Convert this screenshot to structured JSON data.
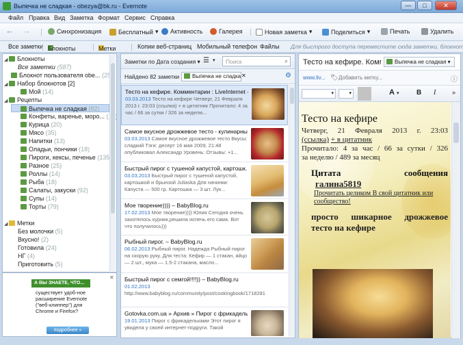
{
  "window": {
    "title": "Выпечка не сладкая - obezya@bk.ru - Evernote",
    "min": "—",
    "max": "□",
    "close": "✕"
  },
  "menu": [
    "Файл",
    "Правка",
    "Вид",
    "Заметка",
    "Формат",
    "Сервис",
    "Справка"
  ],
  "toolbar": {
    "sync": "Синхронизация",
    "account": "Бесплатный",
    "activity": "Активность",
    "gallery": "Галерея",
    "new_note": "Новая заметка",
    "share": "Поделиться",
    "print": "Печать",
    "delete": "Удалить"
  },
  "navbar": {
    "all_notes": "Все заметки",
    "notebooks": "Блокноты",
    "tags": "Метки",
    "web_clips": "Копии веб-страниц",
    "mobile": "Мобильный телефон",
    "files": "Файлы",
    "hint": "Для быстрого доступа переместите сюда заметки, блокноты и ..."
  },
  "sidebar": {
    "notebooks_header": "Блокноты",
    "items": [
      {
        "label": "Все заметки",
        "count": "(587)"
      },
      {
        "label": "Блокнот пользователя obe...",
        "count": "(25)"
      },
      {
        "label": "Набор блокнотов [2]",
        "count": ""
      },
      {
        "label": "Мой",
        "count": "(14)"
      },
      {
        "label": "Рецепты",
        "count": ""
      },
      {
        "label": "Выпечка не сладкая",
        "count": "(82)"
      },
      {
        "label": "Конфеты, варенье, моро...",
        "count": "(15)"
      },
      {
        "label": "Курица",
        "count": "(20)"
      },
      {
        "label": "Мясо",
        "count": "(35)"
      },
      {
        "label": "Напитки",
        "count": "(13)"
      },
      {
        "label": "Оладьи, пончики",
        "count": "(18)"
      },
      {
        "label": "Пироги, кексы, печенье",
        "count": "(135)"
      },
      {
        "label": "Разное",
        "count": "(25)"
      },
      {
        "label": "Роллы",
        "count": "(14)"
      },
      {
        "label": "Рыба",
        "count": "(18)"
      },
      {
        "label": "Салаты, закуски",
        "count": "(92)"
      },
      {
        "label": "Супы",
        "count": "(14)"
      },
      {
        "label": "Торты",
        "count": "(79)"
      }
    ],
    "tags_header": "Метки",
    "tags": [
      {
        "label": "Без молочки",
        "count": "(5)"
      },
      {
        "label": "Вкусно!",
        "count": "(2)"
      },
      {
        "label": "Готовила",
        "count": "(24)"
      },
      {
        "label": "НГ",
        "count": "(4)"
      },
      {
        "label": "Приготовить",
        "count": "(5)"
      }
    ]
  },
  "ad": {
    "banner": "А ВЫ ЗНАЕТЕ, ЧТО...",
    "text": "существует удоб-ное расширение Evernote (\"веб-клиппер\") для Chrome и Firefox?",
    "button": "подробнее »"
  },
  "list": {
    "sort": "Заметки по Дата создания",
    "search_placeholder": "Поиск",
    "found": "Найдено 82 заметки в",
    "found_in": "Выпечка не сладкая",
    "notes": [
      {
        "title": "Тесто на кефире. Комментарии : LiveInternet - ...",
        "date": "03.03.2013",
        "snippet": "Тесто на кефире Четверг, 21 Февраля 2013 г. 23:03 (ссылка) + в цитатник Прочитало: 4 за час / 66 за сутки / 326 за неделю..."
      },
      {
        "title": "Самое вкусное дрожжевое тесто - кулинарны...",
        "date": "03.03.2013",
        "snippet": "Самое вкусное дрожжевое тесто Вкусы: сладкий Тэги: десерт 16 мая 2009, 21:48 опубликовал Александр Уровень: Отзывы: +1..."
      },
      {
        "title": "Быстрый пирог с тушеной капустой, картошк...",
        "date": "03.03.2013",
        "snippet": "Быстрый пирог с тушеной капустой, картошкой и брынзой Juliaska Для начинки: Капуста — 500 гр. Картошка — 3 шт. Лук..."
      },
      {
        "title": "Мое творение)))) – BabyBlog.ru",
        "date": "17.02.2013",
        "snippet": "Мое творение)))) Юлия Сегодня очень захотелось курник,решила испечь его сама. Вот что получилось)))"
      },
      {
        "title": "Рыбный пирог. – BabyBlog.ru",
        "date": "06.02.2013",
        "snippet": "Рыбный пирог. Надежда Рыбный пирог на скорую руку. Для теста: Кефир — 1 стакан, яйцо — 2 шт., мука — 1.5-2 стакана, масло..."
      },
      {
        "title": "Быстрый пирог с семгой!!!!)) – BabyBlog.ru",
        "date": "01.02.2013",
        "snippet": "http://www.babyblog.ru/community/post/cookingbook/1718281"
      },
      {
        "title": "Gotovka.com.ua » Архив » Пирог с фрикадельк...",
        "date": "19.01.2013",
        "snippet": "Пирог с фрикадельками Этот пирог я увидела у своей интернет-подруги. Такой"
      }
    ]
  },
  "note": {
    "title": "Тесто на кефире. Комме",
    "notebook": "Выпечка не сладкая",
    "url": "www.liv...",
    "add_tag": "Добавить метку...",
    "h1": "Тесто на кефире",
    "meta1": "Четверг, 21 Февраля 2013 г. 23:03",
    "link1": "(ссылка)",
    "link2": "+ в цитатник",
    "read1": "Прочитало: 4 за час / 66 за сутки / 326",
    "read2": "за неделю / 489 за месяц",
    "quote": "Цитата сообщения",
    "user": "галина5819",
    "qread1": "Прочитать целиком",
    "qread2": "В свой цитатник или сообщество!",
    "bold": "просто шикарное дрожжевое тесто на кефире"
  },
  "colors": {
    "accent": "#2f72c0",
    "selected": "#c7daf2",
    "evernote": "#3d9b35"
  }
}
